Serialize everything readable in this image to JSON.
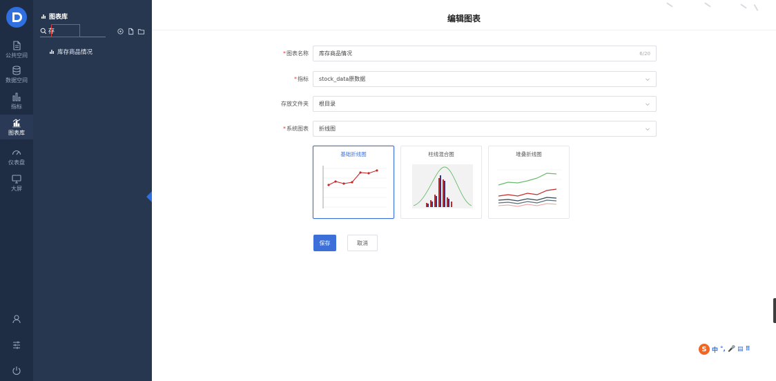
{
  "rail": {
    "items": [
      {
        "label": "公共空间",
        "icon": "document-icon"
      },
      {
        "label": "数据空间",
        "icon": "database-icon"
      },
      {
        "label": "指标",
        "icon": "bar-chart-icon"
      },
      {
        "label": "图表库",
        "icon": "chart-library-icon"
      },
      {
        "label": "仪表盘",
        "icon": "gauge-icon"
      },
      {
        "label": "大屏",
        "icon": "monitor-icon"
      }
    ],
    "bottom_icons": [
      "user-icon",
      "sliders-icon",
      "power-icon"
    ],
    "colors": {
      "background": "#1f2d44",
      "active": "#2a3a56"
    }
  },
  "tree_panel": {
    "title": "图表库",
    "search": {
      "value": "存",
      "placeholder": ""
    },
    "tool_icons": [
      "target-icon",
      "new-file-icon",
      "new-folder-icon"
    ],
    "items": [
      {
        "label": "库存商品情况"
      }
    ],
    "colors": {
      "background": "#27374f"
    }
  },
  "main": {
    "title": "编辑图表",
    "form": {
      "chart_name": {
        "label": "图表名称",
        "value": "库存商品情况",
        "counter": "6/20",
        "required": true
      },
      "metric": {
        "label": "指标",
        "value": "stock_data原数据",
        "required": true
      },
      "folder": {
        "label": "存放文件夹",
        "value": "根目录",
        "required": false
      },
      "chart_type": {
        "label": "系统图表",
        "value": "折线图",
        "required": true
      }
    },
    "chart_options": [
      {
        "label": "基础折线图",
        "selected": true
      },
      {
        "label": "柱线混合图",
        "selected": false
      },
      {
        "label": "堆叠折线图",
        "selected": false
      }
    ],
    "buttons": {
      "save": "保存",
      "cancel": "取消"
    },
    "colors": {
      "primary": "#3c6fd8",
      "required": "#e53935"
    }
  },
  "ime": {
    "logo": "S",
    "items": [
      "中",
      "°,",
      "🎤",
      "▤",
      "⠿"
    ]
  }
}
